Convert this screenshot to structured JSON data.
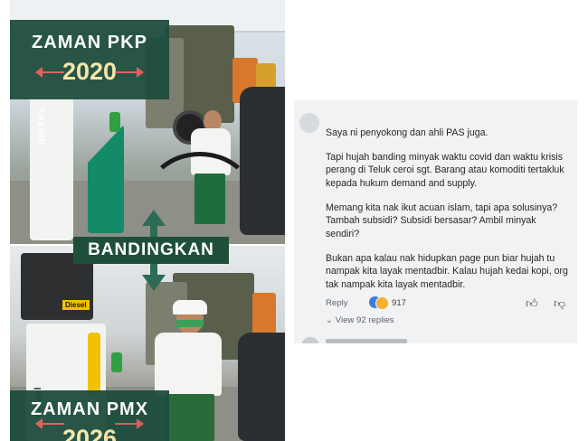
{
  "left_graphic": {
    "top_title": "ZAMAN PKP",
    "top_year": "2020",
    "compare_label": "BANDINGKAN",
    "bottom_title": "ZAMAN PMX",
    "bottom_year": "2026",
    "pump_label_top": "DIESEL",
    "pump_label_bottom": "diesel",
    "pump_tag": "Diesel"
  },
  "comment": {
    "paragraphs": [
      "Saya ni penyokong dan ahli PAS juga.",
      "Tapi hujah banding minyak waktu covid dan waktu krisis perang di Teluk ceroi sgt. Barang atau komoditi tertakluk kepada hukum demand and supply.",
      "Memang kita nak ikut acuan islam, tapi apa solusinya? Tambah subsidi? Subsidi bersasar? Ambil minyak sendiri?",
      "Bukan apa kalau nak hidupkan page pun biar hujah tu nampak kita layak mentadbir. Kalau hujah kedai kopi, org tak nampak kita layak mentadbir."
    ],
    "reply_label": "Reply",
    "reaction_count": "917",
    "view_replies": "View 92 replies",
    "icons": {
      "like_reaction": "thumbs-up-icon",
      "love_reaction": "heart-icon",
      "thumb_up": "thumb-up-outline-icon",
      "thumb_down": "thumb-down-outline-icon",
      "chevron": "chevron-down-icon"
    },
    "colors": {
      "panel_background": "#f1f2f4",
      "like_blue": "#3b7ddd"
    }
  }
}
